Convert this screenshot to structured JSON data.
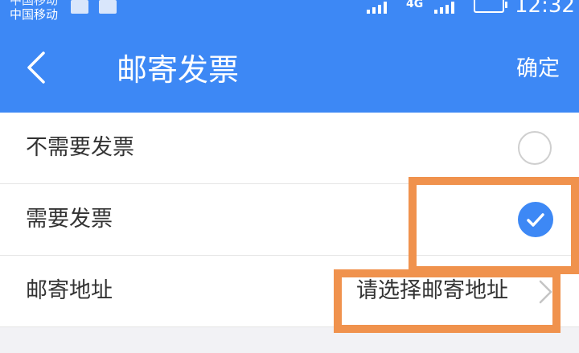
{
  "status_bar": {
    "carrier_top": "中国移动",
    "carrier": "中国移动",
    "network": "4G",
    "time": "12:32"
  },
  "header": {
    "title": "邮寄发票",
    "confirm_label": "确定",
    "background_color": "#3d88f5"
  },
  "options": [
    {
      "label": "不需要发票",
      "selected": false
    },
    {
      "label": "需要发票",
      "selected": true
    }
  ],
  "address_row": {
    "label": "邮寄地址",
    "placeholder": "请选择邮寄地址"
  },
  "colors": {
    "accent": "#3d88f5",
    "highlight": "#f0924d"
  }
}
